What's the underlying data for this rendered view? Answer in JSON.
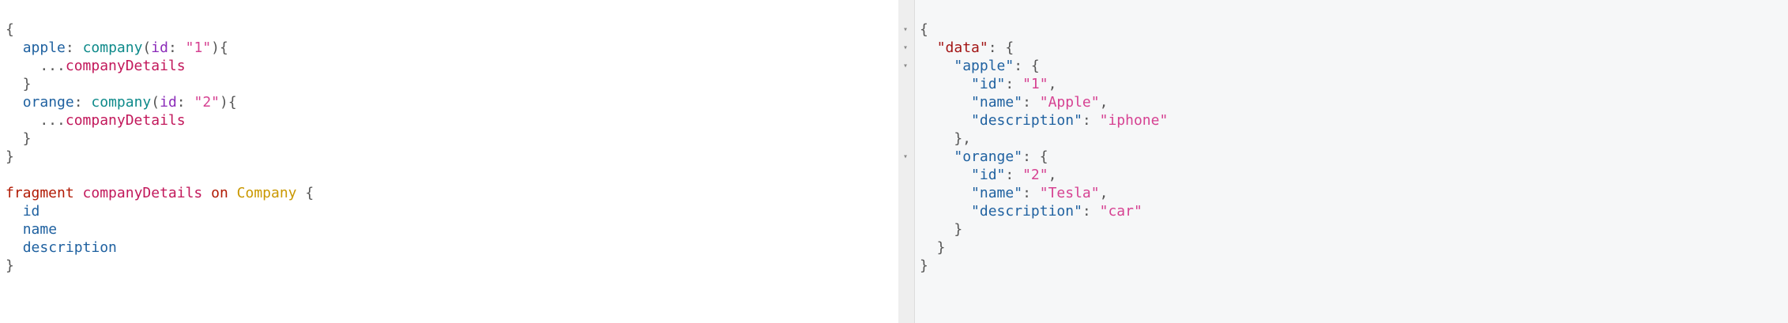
{
  "query_editor": {
    "lines": [
      [
        {
          "c": "p",
          "t": "{"
        }
      ],
      [
        {
          "c": "p",
          "t": "  "
        },
        {
          "c": "f",
          "t": "apple"
        },
        {
          "c": "p",
          "t": ": "
        },
        {
          "c": "fn",
          "t": "company"
        },
        {
          "c": "p",
          "t": "("
        },
        {
          "c": "a",
          "t": "id"
        },
        {
          "c": "p",
          "t": ": "
        },
        {
          "c": "s",
          "t": "\"1\""
        },
        {
          "c": "p",
          "t": "){"
        }
      ],
      [
        {
          "c": "p",
          "t": "    ..."
        },
        {
          "c": "fr",
          "t": "companyDetails"
        }
      ],
      [
        {
          "c": "p",
          "t": "  }"
        }
      ],
      [
        {
          "c": "p",
          "t": "  "
        },
        {
          "c": "f",
          "t": "orange"
        },
        {
          "c": "p",
          "t": ": "
        },
        {
          "c": "fn",
          "t": "company"
        },
        {
          "c": "p",
          "t": "("
        },
        {
          "c": "a",
          "t": "id"
        },
        {
          "c": "p",
          "t": ": "
        },
        {
          "c": "s",
          "t": "\"2\""
        },
        {
          "c": "p",
          "t": "){"
        }
      ],
      [
        {
          "c": "p",
          "t": "    ..."
        },
        {
          "c": "fr",
          "t": "companyDetails"
        }
      ],
      [
        {
          "c": "p",
          "t": "  }"
        }
      ],
      [
        {
          "c": "p",
          "t": "}"
        }
      ],
      [
        {
          "c": "p",
          "t": ""
        }
      ],
      [
        {
          "c": "kw",
          "t": "fragment"
        },
        {
          "c": "p",
          "t": " "
        },
        {
          "c": "fr",
          "t": "companyDetails"
        },
        {
          "c": "p",
          "t": " "
        },
        {
          "c": "kw",
          "t": "on"
        },
        {
          "c": "p",
          "t": " "
        },
        {
          "c": "t",
          "t": "Company"
        },
        {
          "c": "p",
          "t": " {"
        }
      ],
      [
        {
          "c": "p",
          "t": "  "
        },
        {
          "c": "f",
          "t": "id"
        }
      ],
      [
        {
          "c": "p",
          "t": "  "
        },
        {
          "c": "f",
          "t": "name"
        }
      ],
      [
        {
          "c": "p",
          "t": "  "
        },
        {
          "c": "f",
          "t": "description"
        }
      ],
      [
        {
          "c": "p",
          "t": "}"
        }
      ]
    ]
  },
  "result_viewer": {
    "fold_marker": "▾",
    "lines": [
      {
        "fold": true,
        "tokens": [
          {
            "c": "p",
            "t": "{"
          }
        ]
      },
      {
        "fold": true,
        "tokens": [
          {
            "c": "p",
            "t": "  "
          },
          {
            "c": "json-key",
            "t": "\"data\""
          },
          {
            "c": "p",
            "t": ": {"
          }
        ]
      },
      {
        "fold": true,
        "tokens": [
          {
            "c": "p",
            "t": "    "
          },
          {
            "c": "json-key-nested",
            "t": "\"apple\""
          },
          {
            "c": "p",
            "t": ": {"
          }
        ]
      },
      {
        "fold": false,
        "tokens": [
          {
            "c": "p",
            "t": "      "
          },
          {
            "c": "json-key-nested",
            "t": "\"id\""
          },
          {
            "c": "p",
            "t": ": "
          },
          {
            "c": "s",
            "t": "\"1\""
          },
          {
            "c": "p",
            "t": ","
          }
        ]
      },
      {
        "fold": false,
        "tokens": [
          {
            "c": "p",
            "t": "      "
          },
          {
            "c": "json-key-nested",
            "t": "\"name\""
          },
          {
            "c": "p",
            "t": ": "
          },
          {
            "c": "s",
            "t": "\"Apple\""
          },
          {
            "c": "p",
            "t": ","
          }
        ]
      },
      {
        "fold": false,
        "tokens": [
          {
            "c": "p",
            "t": "      "
          },
          {
            "c": "json-key-nested",
            "t": "\"description\""
          },
          {
            "c": "p",
            "t": ": "
          },
          {
            "c": "s",
            "t": "\"iphone\""
          }
        ]
      },
      {
        "fold": false,
        "tokens": [
          {
            "c": "p",
            "t": "    },"
          }
        ]
      },
      {
        "fold": true,
        "tokens": [
          {
            "c": "p",
            "t": "    "
          },
          {
            "c": "json-key-nested",
            "t": "\"orange\""
          },
          {
            "c": "p",
            "t": ": {"
          }
        ]
      },
      {
        "fold": false,
        "tokens": [
          {
            "c": "p",
            "t": "      "
          },
          {
            "c": "json-key-nested",
            "t": "\"id\""
          },
          {
            "c": "p",
            "t": ": "
          },
          {
            "c": "s",
            "t": "\"2\""
          },
          {
            "c": "p",
            "t": ","
          }
        ]
      },
      {
        "fold": false,
        "tokens": [
          {
            "c": "p",
            "t": "      "
          },
          {
            "c": "json-key-nested",
            "t": "\"name\""
          },
          {
            "c": "p",
            "t": ": "
          },
          {
            "c": "s",
            "t": "\"Tesla\""
          },
          {
            "c": "p",
            "t": ","
          }
        ]
      },
      {
        "fold": false,
        "tokens": [
          {
            "c": "p",
            "t": "      "
          },
          {
            "c": "json-key-nested",
            "t": "\"description\""
          },
          {
            "c": "p",
            "t": ": "
          },
          {
            "c": "s",
            "t": "\"car\""
          }
        ]
      },
      {
        "fold": false,
        "tokens": [
          {
            "c": "p",
            "t": "    }"
          }
        ]
      },
      {
        "fold": false,
        "tokens": [
          {
            "c": "p",
            "t": "  }"
          }
        ]
      },
      {
        "fold": false,
        "tokens": [
          {
            "c": "p",
            "t": "}"
          }
        ]
      }
    ]
  }
}
